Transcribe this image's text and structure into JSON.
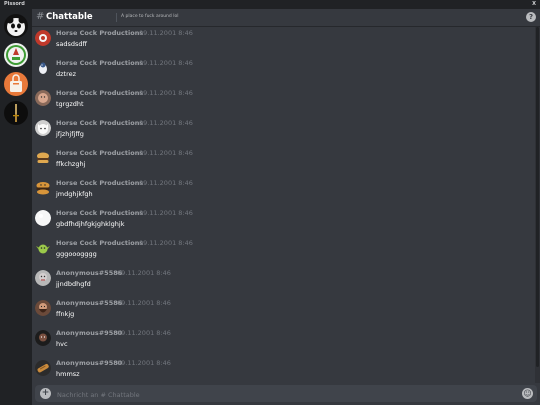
{
  "window": {
    "title": "Pissord",
    "close_label": "X"
  },
  "servers": [
    {
      "name": "panda-server",
      "icon": "panda"
    },
    {
      "name": "sign-server",
      "icon": "sign"
    },
    {
      "name": "bag-server",
      "icon": "bag"
    },
    {
      "name": "sword-server",
      "icon": "sword"
    }
  ],
  "channel": {
    "hash": "#",
    "name": "Chattable",
    "topic": "A place to fuck around lol",
    "help": "?"
  },
  "messages": [
    {
      "author": "Horse Cock Productions",
      "time": "09.11.2001 8:46",
      "text": "sadsdsdff",
      "avatar": "red-logo"
    },
    {
      "author": "Horse Cock Productions",
      "time": "09.11.2001 8:46",
      "text": "dztrez",
      "avatar": "penguin"
    },
    {
      "author": "Horse Cock Productions",
      "time": "09.11.2001 8:46",
      "text": "tgrgzdht",
      "avatar": "face"
    },
    {
      "author": "Horse Cock Productions",
      "time": "09.11.2001 8:46",
      "text": "jfjzhjfjffg",
      "avatar": "cat"
    },
    {
      "author": "Horse Cock Productions",
      "time": "09.11.2001 8:46",
      "text": "ffkchzghj",
      "avatar": "burger"
    },
    {
      "author": "Horse Cock Productions",
      "time": "09.11.2001 8:46",
      "text": "jmdghjkfgh",
      "avatar": "burger-face"
    },
    {
      "author": "Horse Cock Productions",
      "time": "09.11.2001 8:46",
      "text": "gbdfhdjhfgkjghklghjk",
      "avatar": "white-ball"
    },
    {
      "author": "Horse Cock Productions",
      "time": "09.11.2001 8:46",
      "text": "gggooogggg",
      "avatar": "goblin"
    },
    {
      "author": "Anonymous#5586",
      "time": "09.11.2001 8:46",
      "text": "jjndbdhgfd",
      "avatar": "gray-face"
    },
    {
      "author": "Anonymous#5586",
      "time": "09.11.2001 8:46",
      "text": "ffnkjg",
      "avatar": "bearded-man"
    },
    {
      "author": "Anonymous#9580",
      "time": "09.11.2001 8:46",
      "text": "hvc",
      "avatar": "dark-man"
    },
    {
      "author": "Anonymous#9580",
      "time": "09.11.2001 8:46",
      "text": "hmmsz",
      "avatar": "bread"
    }
  ],
  "composer": {
    "placeholder": "Nachricht an # Chattable",
    "plus": "+",
    "emoji": "☺"
  },
  "colors": {
    "background": "#36393f",
    "sidebar": "#202225",
    "composer": "#40444b",
    "author": "#9ea1a6",
    "timestamp": "#72767d",
    "message": "#ffffff"
  }
}
